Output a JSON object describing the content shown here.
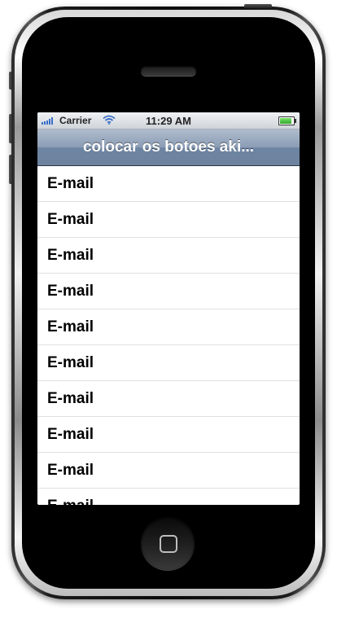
{
  "status_bar": {
    "carrier": "Carrier",
    "time": "11:29 AM"
  },
  "nav_bar": {
    "title": "colocar os botoes aki..."
  },
  "table": {
    "rows": [
      {
        "label": "E-mail"
      },
      {
        "label": "E-mail"
      },
      {
        "label": "E-mail"
      },
      {
        "label": "E-mail"
      },
      {
        "label": "E-mail"
      },
      {
        "label": "E-mail"
      },
      {
        "label": "E-mail"
      },
      {
        "label": "E-mail"
      },
      {
        "label": "E-mail"
      },
      {
        "label": "E-mail"
      }
    ]
  },
  "icons": [
    "signal-icon",
    "wifi-icon",
    "battery-icon",
    "home-button-icon"
  ],
  "colors": {
    "nav_bar": "#7088a6",
    "signal": "#3a6fc8",
    "battery": "#2fa82a"
  }
}
